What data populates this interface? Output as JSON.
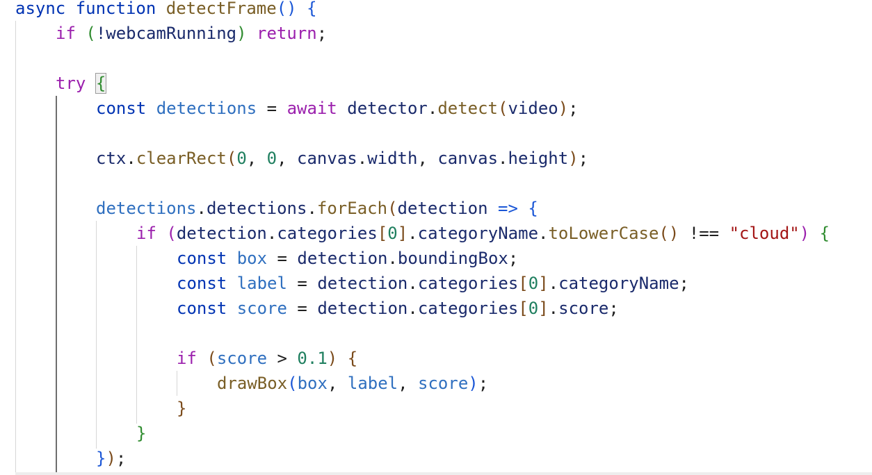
{
  "colors": {
    "keyword_blue": "#0033b3",
    "keyword_purple": "#9b20ad",
    "function_brown": "#795e26",
    "variable_blue": "#2f6fbf",
    "property_navy": "#1a2a6b",
    "plain": "#202020",
    "number_green": "#1f7f5f",
    "string_red": "#a31515",
    "bracket_blue": "#1a56d6",
    "bracket_purple": "#9b20ad",
    "bracket_green": "#2e8b2e",
    "bracket_brown": "#7a4a1a"
  },
  "code_lines": [
    {
      "indent": 0,
      "tokens": [
        {
          "t": "async",
          "c": "keyword_blue"
        },
        {
          "t": " "
        },
        {
          "t": "function",
          "c": "keyword_blue"
        },
        {
          "t": " "
        },
        {
          "t": "detectFrame",
          "c": "function_brown"
        },
        {
          "t": "()",
          "c": "bracket_blue"
        },
        {
          "t": " "
        },
        {
          "t": "{",
          "c": "bracket_blue"
        }
      ]
    },
    {
      "indent": 1,
      "tokens": [
        {
          "t": "if",
          "c": "keyword_purple"
        },
        {
          "t": " "
        },
        {
          "t": "(",
          "c": "bracket_green"
        },
        {
          "t": "!webcamRunning",
          "c": "property_navy"
        },
        {
          "t": ")",
          "c": "bracket_green"
        },
        {
          "t": " "
        },
        {
          "t": "return",
          "c": "keyword_purple"
        },
        {
          "t": ";",
          "c": "plain"
        }
      ]
    },
    {
      "indent": 0,
      "tokens": []
    },
    {
      "indent": 1,
      "tokens": [
        {
          "t": "try",
          "c": "keyword_purple"
        },
        {
          "t": " "
        },
        {
          "t": "{",
          "c": "bracket_green",
          "match": true
        }
      ]
    },
    {
      "indent": 2,
      "tokens": [
        {
          "t": "const",
          "c": "keyword_blue"
        },
        {
          "t": " "
        },
        {
          "t": "detections",
          "c": "variable_blue"
        },
        {
          "t": " = ",
          "c": "plain"
        },
        {
          "t": "await",
          "c": "keyword_purple"
        },
        {
          "t": " "
        },
        {
          "t": "detector",
          "c": "property_navy"
        },
        {
          "t": ".",
          "c": "plain"
        },
        {
          "t": "detect",
          "c": "function_brown"
        },
        {
          "t": "(",
          "c": "bracket_brown"
        },
        {
          "t": "video",
          "c": "property_navy"
        },
        {
          "t": ")",
          "c": "bracket_brown"
        },
        {
          "t": ";",
          "c": "plain"
        }
      ]
    },
    {
      "indent": 0,
      "tokens": []
    },
    {
      "indent": 2,
      "tokens": [
        {
          "t": "ctx",
          "c": "property_navy"
        },
        {
          "t": ".",
          "c": "plain"
        },
        {
          "t": "clearRect",
          "c": "function_brown"
        },
        {
          "t": "(",
          "c": "bracket_brown"
        },
        {
          "t": "0",
          "c": "number_green"
        },
        {
          "t": ", ",
          "c": "plain"
        },
        {
          "t": "0",
          "c": "number_green"
        },
        {
          "t": ", ",
          "c": "plain"
        },
        {
          "t": "canvas",
          "c": "property_navy"
        },
        {
          "t": ".",
          "c": "plain"
        },
        {
          "t": "width",
          "c": "property_navy"
        },
        {
          "t": ", ",
          "c": "plain"
        },
        {
          "t": "canvas",
          "c": "property_navy"
        },
        {
          "t": ".",
          "c": "plain"
        },
        {
          "t": "height",
          "c": "property_navy"
        },
        {
          "t": ")",
          "c": "bracket_brown"
        },
        {
          "t": ";",
          "c": "plain"
        }
      ]
    },
    {
      "indent": 0,
      "tokens": []
    },
    {
      "indent": 2,
      "tokens": [
        {
          "t": "detections",
          "c": "variable_blue"
        },
        {
          "t": ".",
          "c": "plain"
        },
        {
          "t": "detections",
          "c": "property_navy"
        },
        {
          "t": ".",
          "c": "plain"
        },
        {
          "t": "forEach",
          "c": "function_brown"
        },
        {
          "t": "(",
          "c": "bracket_brown"
        },
        {
          "t": "detection",
          "c": "property_navy"
        },
        {
          "t": " ",
          "c": "plain"
        },
        {
          "t": "=>",
          "c": "bracket_blue"
        },
        {
          "t": " ",
          "c": "plain"
        },
        {
          "t": "{",
          "c": "bracket_blue"
        }
      ]
    },
    {
      "indent": 3,
      "tokens": [
        {
          "t": "if",
          "c": "keyword_purple"
        },
        {
          "t": " "
        },
        {
          "t": "(",
          "c": "bracket_purple"
        },
        {
          "t": "detection",
          "c": "property_navy"
        },
        {
          "t": ".",
          "c": "plain"
        },
        {
          "t": "categories",
          "c": "property_navy"
        },
        {
          "t": "[",
          "c": "bracket_brown"
        },
        {
          "t": "0",
          "c": "number_green"
        },
        {
          "t": "]",
          "c": "bracket_brown"
        },
        {
          "t": ".",
          "c": "plain"
        },
        {
          "t": "categoryName",
          "c": "property_navy"
        },
        {
          "t": ".",
          "c": "plain"
        },
        {
          "t": "toLowerCase",
          "c": "function_brown"
        },
        {
          "t": "()",
          "c": "bracket_brown"
        },
        {
          "t": " !== ",
          "c": "plain"
        },
        {
          "t": "\"cloud\"",
          "c": "string_red"
        },
        {
          "t": ")",
          "c": "bracket_purple"
        },
        {
          "t": " ",
          "c": "plain"
        },
        {
          "t": "{",
          "c": "bracket_green"
        }
      ]
    },
    {
      "indent": 4,
      "tokens": [
        {
          "t": "const",
          "c": "keyword_blue"
        },
        {
          "t": " "
        },
        {
          "t": "box",
          "c": "variable_blue"
        },
        {
          "t": " = ",
          "c": "plain"
        },
        {
          "t": "detection",
          "c": "property_navy"
        },
        {
          "t": ".",
          "c": "plain"
        },
        {
          "t": "boundingBox",
          "c": "property_navy"
        },
        {
          "t": ";",
          "c": "plain"
        }
      ]
    },
    {
      "indent": 4,
      "tokens": [
        {
          "t": "const",
          "c": "keyword_blue"
        },
        {
          "t": " "
        },
        {
          "t": "label",
          "c": "variable_blue"
        },
        {
          "t": " = ",
          "c": "plain"
        },
        {
          "t": "detection",
          "c": "property_navy"
        },
        {
          "t": ".",
          "c": "plain"
        },
        {
          "t": "categories",
          "c": "property_navy"
        },
        {
          "t": "[",
          "c": "bracket_brown"
        },
        {
          "t": "0",
          "c": "number_green"
        },
        {
          "t": "]",
          "c": "bracket_brown"
        },
        {
          "t": ".",
          "c": "plain"
        },
        {
          "t": "categoryName",
          "c": "property_navy"
        },
        {
          "t": ";",
          "c": "plain"
        }
      ]
    },
    {
      "indent": 4,
      "tokens": [
        {
          "t": "const",
          "c": "keyword_blue"
        },
        {
          "t": " "
        },
        {
          "t": "score",
          "c": "variable_blue"
        },
        {
          "t": " = ",
          "c": "plain"
        },
        {
          "t": "detection",
          "c": "property_navy"
        },
        {
          "t": ".",
          "c": "plain"
        },
        {
          "t": "categories",
          "c": "property_navy"
        },
        {
          "t": "[",
          "c": "bracket_brown"
        },
        {
          "t": "0",
          "c": "number_green"
        },
        {
          "t": "]",
          "c": "bracket_brown"
        },
        {
          "t": ".",
          "c": "plain"
        },
        {
          "t": "score",
          "c": "property_navy"
        },
        {
          "t": ";",
          "c": "plain"
        }
      ]
    },
    {
      "indent": 0,
      "tokens": []
    },
    {
      "indent": 4,
      "tokens": [
        {
          "t": "if",
          "c": "keyword_purple"
        },
        {
          "t": " "
        },
        {
          "t": "(",
          "c": "bracket_brown"
        },
        {
          "t": "score",
          "c": "variable_blue"
        },
        {
          "t": " > ",
          "c": "plain"
        },
        {
          "t": "0.1",
          "c": "number_green"
        },
        {
          "t": ")",
          "c": "bracket_brown"
        },
        {
          "t": " ",
          "c": "plain"
        },
        {
          "t": "{",
          "c": "bracket_brown"
        }
      ]
    },
    {
      "indent": 5,
      "tokens": [
        {
          "t": "drawBox",
          "c": "function_brown"
        },
        {
          "t": "(",
          "c": "bracket_blue"
        },
        {
          "t": "box",
          "c": "variable_blue"
        },
        {
          "t": ", ",
          "c": "plain"
        },
        {
          "t": "label",
          "c": "variable_blue"
        },
        {
          "t": ", ",
          "c": "plain"
        },
        {
          "t": "score",
          "c": "variable_blue"
        },
        {
          "t": ")",
          "c": "bracket_blue"
        },
        {
          "t": ";",
          "c": "plain"
        }
      ]
    },
    {
      "indent": 4,
      "tokens": [
        {
          "t": "}",
          "c": "bracket_brown"
        }
      ]
    },
    {
      "indent": 3,
      "tokens": [
        {
          "t": "}",
          "c": "bracket_green"
        }
      ]
    },
    {
      "indent": 2,
      "tokens": [
        {
          "t": "}",
          "c": "bracket_blue"
        },
        {
          "t": ")",
          "c": "bracket_brown"
        },
        {
          "t": ";",
          "c": "plain"
        }
      ]
    }
  ]
}
